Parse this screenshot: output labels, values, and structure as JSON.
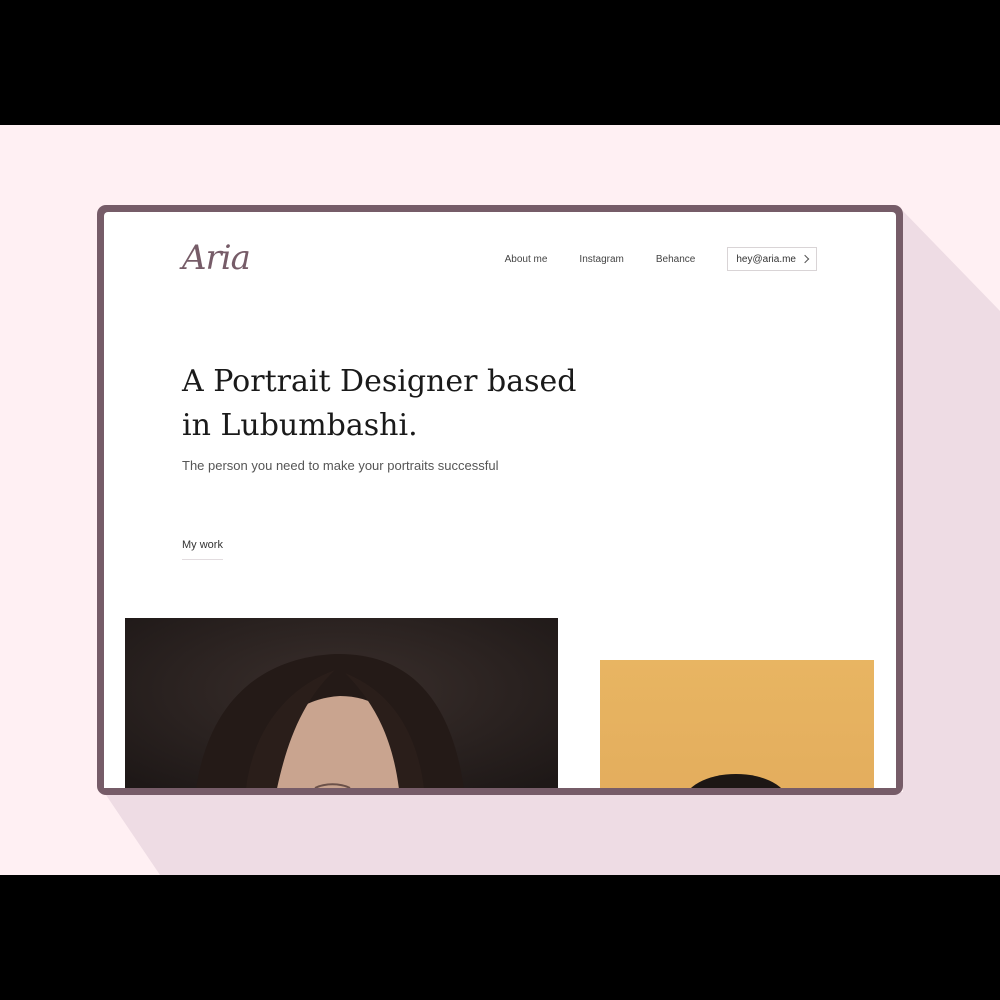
{
  "brand": {
    "logo": "Aria"
  },
  "nav": {
    "about": "About me",
    "instagram": "Instagram",
    "behance": "Behance",
    "email": "hey@aria.me"
  },
  "hero": {
    "title": "A Portrait Designer based in Lubumbashi.",
    "subtitle": "The person you need to make your portraits successful",
    "cta": "My work"
  },
  "colors": {
    "background": "#fff0f3",
    "shadow": "#eedce4",
    "frame": "#765c68",
    "accent_photo": "#e5b05f"
  },
  "icons": {
    "email_button": "chevron-right-icon"
  }
}
